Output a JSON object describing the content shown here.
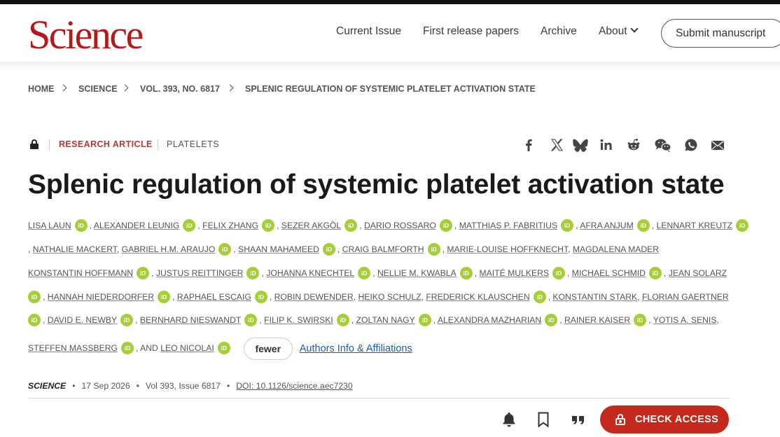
{
  "brand": {
    "logo": "Science",
    "color": "#b31b1b"
  },
  "nav": {
    "current_issue": "Current Issue",
    "first_release": "First release papers",
    "archive": "Archive",
    "about": "About",
    "submit": "Submit manuscript"
  },
  "breadcrumb": [
    "HOME",
    "SCIENCE",
    "VOL. 393, NO. 6817",
    "SPLENIC REGULATION OF SYSTEMIC PLATELET ACTIVATION STATE"
  ],
  "article": {
    "type": "RESEARCH ARTICLE",
    "subject": "PLATELETS",
    "title": "Splenic regulation of systemic platelet activation state"
  },
  "share_icons": [
    "facebook-icon",
    "x-icon",
    "bluesky-icon",
    "linkedin-icon",
    "reddit-icon",
    "wechat-icon",
    "whatsapp-icon",
    "email-icon"
  ],
  "orcid_label": "iD",
  "authors": [
    "LISA LAUN",
    "ALEXANDER LEUNIG",
    "FELIX ZHANG",
    "SEZER AKGÖL",
    "DARIO ROSSARO",
    "MATTHIAS P. FABRITIUS",
    "AFRA ANJUM",
    "LENNART KREUTZ",
    "NATHALIE MACKERT",
    "GABRIEL H.M. ARAUJO",
    "SHAAN MAHAMEED",
    "CRAIG BALMFORTH",
    "MARIE-LOUISE HOFFKNECHT",
    "MAGDALENA MADER",
    "KONSTANTIN HOFFMANN",
    "JUSTUS REITTINGER",
    "JOHANNA KNECHTEL",
    "NELLIE M. KWABLA",
    "MAITÉ MULKERS",
    "MICHAEL SCHMID",
    "JEAN SOLARZ",
    "HANNAH NIEDERDORFER",
    "RAPHAEL ESCAIG",
    "ROBIN DEWENDER",
    "HEIKO SCHULZ",
    "FREDERICK KLAUSCHEN",
    "KONSTANTIN STARK",
    "FLORIAN GAERTNER",
    "DAVID E. NEWBY",
    "BERNHARD NIESWANDT",
    "FILIP K. SWIRSKI",
    "ZOLTAN NAGY",
    "ALEXANDRA MAZHARIAN",
    "RAINER KAISER",
    "YOTIS A. SENIS",
    "STEFFEN MASSBERG",
    "LEO NICOLAI"
  ],
  "author_separator": ",",
  "and_text": ", AND",
  "fewer_label": "fewer",
  "affiliations_label": "Authors Info & Affiliations",
  "meta": {
    "journal": "SCIENCE",
    "dot": "•",
    "date": "17 Sep 2026",
    "volume": "Vol 393, Issue 6817",
    "doi": "DOI: 10.1126/science.aec7230"
  },
  "check_access": "CHECK ACCESS",
  "action_icons": [
    "bell-icon",
    "bookmark-icon",
    "cite-icon"
  ],
  "colors": {
    "accent": "#c5281c",
    "orcid": "#a6ce39",
    "link": "#1a5ea8"
  }
}
